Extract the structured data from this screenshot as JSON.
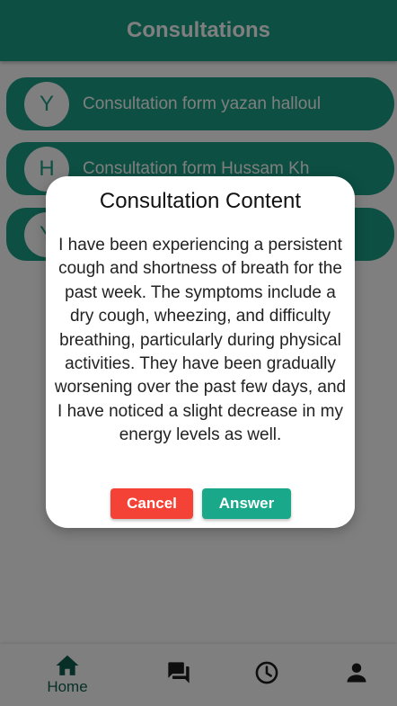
{
  "colors": {
    "primary": "#1a9e86",
    "nav_active": "#0f5f51",
    "nav_icon": "#1c1c1c",
    "cancel": "#f44336",
    "answer": "#1aa88b",
    "overlay": "rgba(0,0,0,0.5)"
  },
  "appbar": {
    "title": "Consultations"
  },
  "consultations": [
    {
      "initial": "Y",
      "label": "Consultation form yazan halloul"
    },
    {
      "initial": "H",
      "label": "Consultation form Hussam Kh"
    },
    {
      "initial": "Y",
      "label": ""
    }
  ],
  "dialog": {
    "title": "Consultation Content",
    "body": "I have been experiencing a persistent cough and shortness of breath for the past week. The symptoms include a dry cough, wheezing, and difficulty breathing, particularly during physical activities. They have been gradually worsening over the past few days, and I have noticed a slight decrease in my energy levels as well.",
    "cancel_label": "Cancel",
    "answer_label": "Answer"
  },
  "bottom_nav": {
    "items": [
      {
        "icon": "home-icon",
        "label": "Home",
        "active": true
      },
      {
        "icon": "chat-icon",
        "label": ""
      },
      {
        "icon": "clock-icon",
        "label": ""
      },
      {
        "icon": "person-icon",
        "label": ""
      }
    ]
  }
}
